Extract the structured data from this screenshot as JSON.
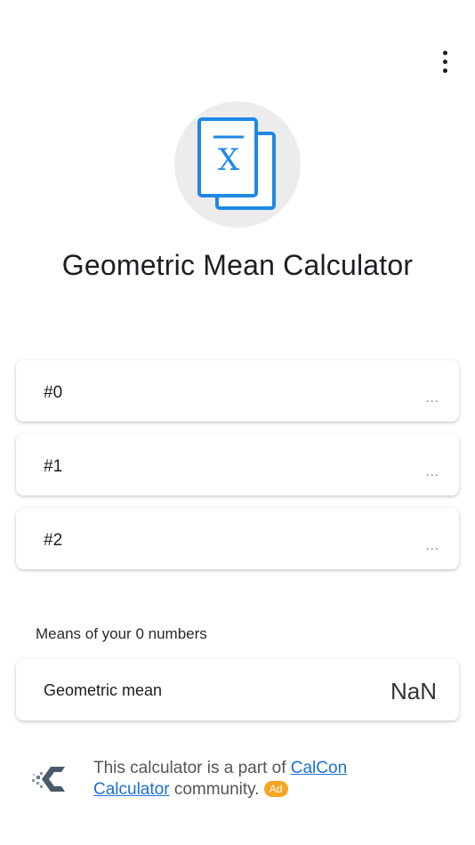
{
  "header": {
    "menu_icon": "more-vert-icon"
  },
  "logo": {
    "icon": "x-bar-icon",
    "symbol": "X",
    "accent_color": "#1e88e5",
    "background_color": "#ececec"
  },
  "title": "Geometric Mean Calculator",
  "inputs": [
    {
      "label": "#0",
      "placeholder": "..."
    },
    {
      "label": "#1",
      "placeholder": "..."
    },
    {
      "label": "#2",
      "placeholder": "..."
    }
  ],
  "results": {
    "section_label": "Means of your 0 numbers",
    "geometric_mean_label": "Geometric mean",
    "geometric_mean_value": "NaN"
  },
  "footer": {
    "text_before": "This calculator is a part of ",
    "link_calcon": "CalCon",
    "link_calculator": "Calculator",
    "text_after": " community.",
    "ad_badge": "Ad",
    "link_color": "#1a6fd8",
    "ad_color": "#f5a623"
  }
}
